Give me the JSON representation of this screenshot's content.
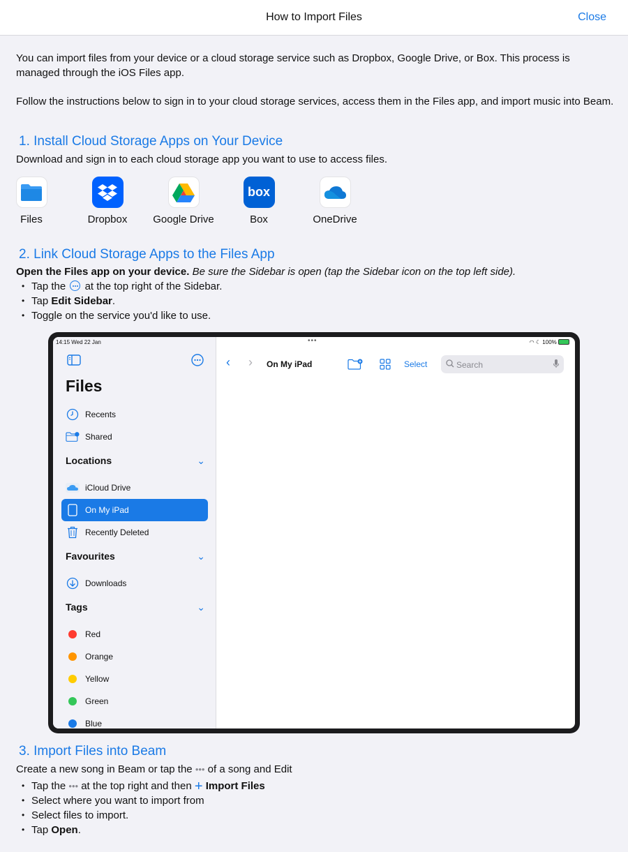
{
  "nav": {
    "title": "How to Import Files",
    "close_label": "Close"
  },
  "intro": {
    "p1": "You can import files from your device or a cloud storage service such as Dropbox, Google Drive, or Box. This process is managed through the iOS Files app.",
    "p2": "Follow the instructions below to sign in to your cloud storage services, access them in the Files app, and import music into Beam."
  },
  "section1": {
    "title": "1. Install Cloud Storage Apps on Your Device",
    "desc": "Download and sign in to each cloud storage app you want to use to access files.",
    "apps": [
      {
        "name": "Files",
        "icon": "files-app-icon"
      },
      {
        "name": "Dropbox",
        "icon": "dropbox-icon"
      },
      {
        "name": "Google Drive",
        "icon": "google-drive-icon"
      },
      {
        "name": "Box",
        "icon": "box-icon"
      },
      {
        "name": "OneDrive",
        "icon": "onedrive-icon"
      }
    ]
  },
  "section2": {
    "title": "2. Link Cloud Storage Apps to the Files App",
    "desc_bold": "Open the Files app on your device.",
    "desc_italic": "Be sure the Sidebar is open (tap the Sidebar icon on the top left side).",
    "b1_pre": "Tap the",
    "b1_post": "at the top right of the Sidebar.",
    "b2_pre": "Tap",
    "b2_bold": "Edit Sidebar",
    "b2_post": ".",
    "b3": "Toggle on the service you'd like to use."
  },
  "ipad": {
    "status_time": "14:15  Wed 22 Jan",
    "status_right": "100%",
    "files_title": "Files",
    "recents": "Recents",
    "shared": "Shared",
    "locations": "Locations",
    "icloud": "iCloud Drive",
    "onmyipad": "On My iPad",
    "recently_deleted": "Recently Deleted",
    "favourites": "Favourites",
    "downloads": "Downloads",
    "tags": "Tags",
    "tag_list": [
      {
        "name": "Red",
        "color": "#ff3b30"
      },
      {
        "name": "Orange",
        "color": "#ff9500"
      },
      {
        "name": "Yellow",
        "color": "#ffcc00"
      },
      {
        "name": "Green",
        "color": "#34c759"
      },
      {
        "name": "Blue",
        "color": "#1a7ae6"
      }
    ],
    "toolbar_title": "On My iPad",
    "select_label": "Select",
    "search_placeholder": "Search"
  },
  "section3": {
    "title": "3. Import Files into Beam",
    "desc_pre": "Create a new song in Beam or tap the",
    "desc_post": "of a song and Edit",
    "b1_pre": "Tap the",
    "b1_mid": "at the top right and then",
    "b1_bold": "Import Files",
    "b2": "Select where you want to import from",
    "b3": "Select files to import.",
    "b4_pre": "Tap",
    "b4_bold": "Open",
    "b4_post": "."
  },
  "colors": {
    "accent": "#1a7ae6",
    "background": "#f2f2f7"
  }
}
